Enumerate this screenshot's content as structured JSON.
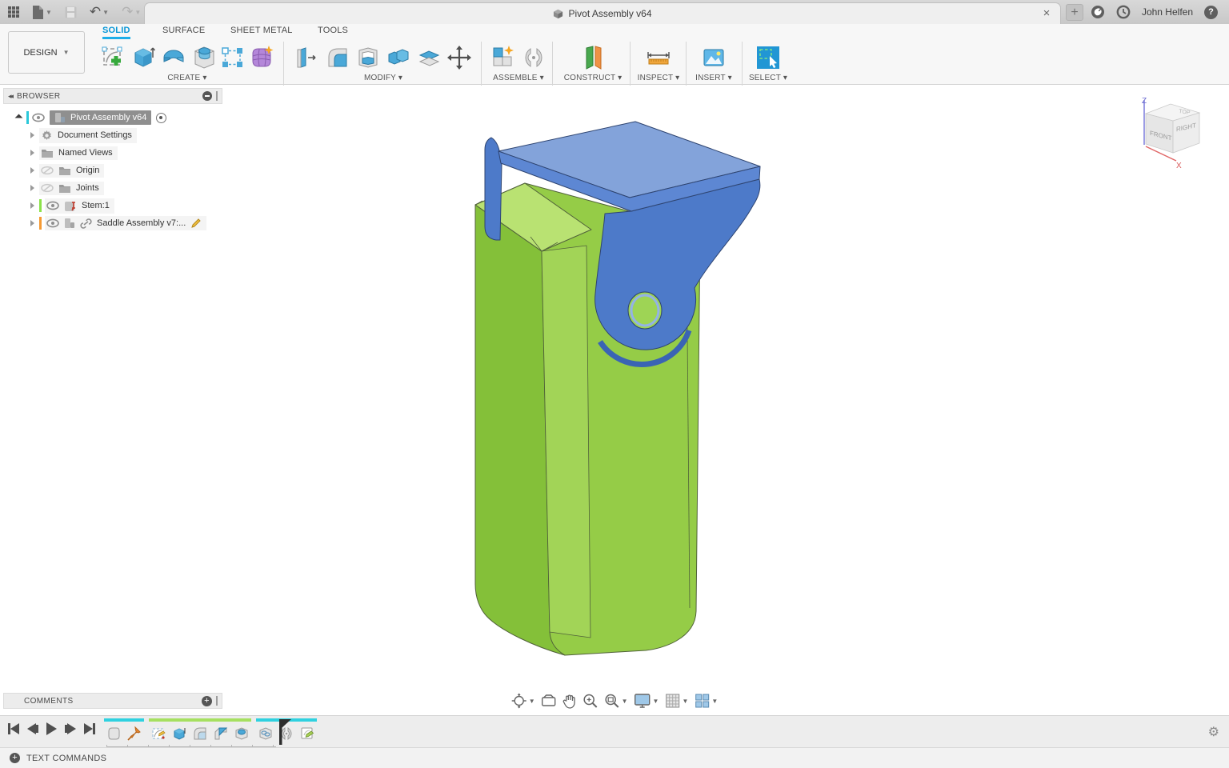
{
  "titlebar": {
    "title": "Pivot Assembly v64",
    "user": "John Helfen",
    "close_label": "×",
    "new_tab_label": "+",
    "help_label": "?",
    "left_icons": [
      "app-grid-icon",
      "file-icon",
      "save-icon",
      "undo-icon",
      "redo-icon"
    ],
    "right_icons": [
      "extensions-icon",
      "job-status-icon",
      "help-icon"
    ]
  },
  "ribbon": {
    "workspace_label": "DESIGN",
    "tabs": [
      {
        "label": "SOLID",
        "active": true
      },
      {
        "label": "SURFACE",
        "active": false
      },
      {
        "label": "SHEET METAL",
        "active": false
      },
      {
        "label": "TOOLS",
        "active": false
      }
    ],
    "groups": [
      {
        "label": "CREATE",
        "icons": [
          "create-sketch",
          "extrude",
          "revolve",
          "hole",
          "pattern",
          "create-form"
        ]
      },
      {
        "label": "MODIFY",
        "icons": [
          "press-pull",
          "fillet",
          "shell",
          "combine",
          "offset-face",
          "move"
        ]
      },
      {
        "label": "ASSEMBLE",
        "icons": [
          "new-component",
          "joint"
        ]
      },
      {
        "label": "CONSTRUCT",
        "icons": [
          "construction-plane"
        ]
      },
      {
        "label": "INSPECT",
        "icons": [
          "measure"
        ]
      },
      {
        "label": "INSERT",
        "icons": [
          "insert-image"
        ]
      },
      {
        "label": "SELECT",
        "icons": [
          "select"
        ]
      }
    ]
  },
  "browser": {
    "header": "BROWSER",
    "items": [
      {
        "label": "Pivot Assembly v64",
        "icon": "assembly",
        "selected": true,
        "bar_color": "#2bc8da",
        "activated": true
      },
      {
        "label": "Document Settings",
        "icon": "gear"
      },
      {
        "label": "Named Views",
        "icon": "folder"
      },
      {
        "label": "Origin",
        "icon": "folder",
        "hidden": true
      },
      {
        "label": "Joints",
        "icon": "folder",
        "hidden": true
      },
      {
        "label": "Stem:1",
        "icon": "grounded-component",
        "bar_color": "#8ce24a"
      },
      {
        "label": "Saddle Assembly v7:...",
        "icon": "linked-component",
        "bar_color": "#f59a33",
        "editable": true
      }
    ]
  },
  "viewcube": {
    "top": "TOP",
    "front": "FRONT",
    "right": "RIGHT",
    "z": "Z",
    "x": "X"
  },
  "navbar": {
    "icons": [
      "orbit",
      "look-at",
      "pan",
      "zoom",
      "fit",
      "display-settings",
      "grid-settings",
      "viewports"
    ]
  },
  "comments": {
    "label": "COMMENTS"
  },
  "timeline": {
    "playback": [
      "go-to-start",
      "step-back",
      "play",
      "step-forward",
      "go-to-end"
    ],
    "features": [
      "component",
      "ground-pin",
      "sketch",
      "extrude",
      "fillet",
      "chamfer",
      "hole",
      "pattern",
      "joint",
      "sketch-edit"
    ],
    "group_bars": [
      "#2fd1e0",
      "#a6e060",
      "#2fd1e0"
    ]
  },
  "text_commands": {
    "label": "TEXT COMMANDS"
  },
  "model": {
    "stem_color": "#8dc63f",
    "saddle_color": "#4d7ac9",
    "accent_blue": "#0696d7"
  }
}
